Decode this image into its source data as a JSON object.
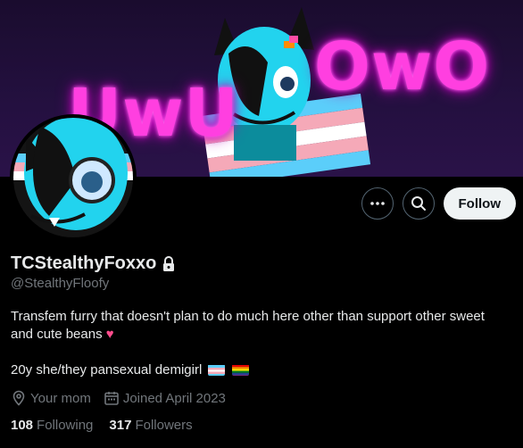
{
  "banner": {
    "left_text": "UwU",
    "right_text": "OwO"
  },
  "actions": {
    "follow_label": "Follow"
  },
  "profile": {
    "display_name": "TCStealthyFoxxo",
    "handle": "@StealthyFloofy",
    "bio_line1": "Transfem furry that doesn't plan to do much here other than support other sweet",
    "bio_line2": "and cute beans",
    "bio_line3": "20y she/they pansexual demigirl",
    "location": "Your mom",
    "joined": "Joined April 2023",
    "following_count": "108",
    "following_label": "Following",
    "followers_count": "317",
    "followers_label": "Followers"
  },
  "colors": {
    "neon_pink": "#ff3fe0",
    "cyan": "#22d3ee",
    "follow_bg": "#eff3f4",
    "secondary_text": "#71767b"
  },
  "icons": [
    "more-icon",
    "search-icon",
    "lock-icon",
    "location-icon",
    "calendar-icon",
    "sparkling-heart-icon",
    "trans-flag-icon",
    "rainbow-flag-icon"
  ]
}
